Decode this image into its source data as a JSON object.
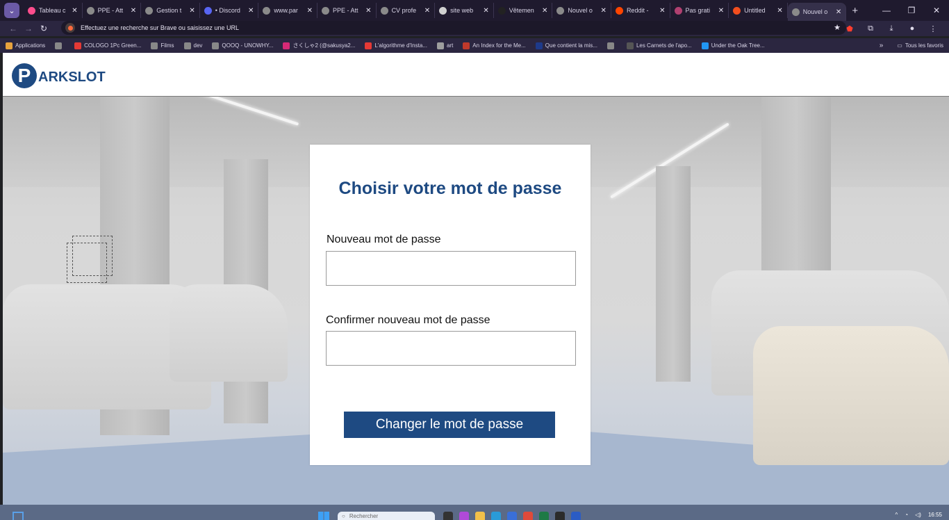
{
  "browser": {
    "tabs": [
      {
        "label": "Tableau c",
        "color": "#ff4d8d",
        "icon": "invision-icon"
      },
      {
        "label": "PPE - Att",
        "color": "#8a8a8a",
        "icon": "globe-icon"
      },
      {
        "label": "Gestion t",
        "color": "#8a8a8a",
        "icon": "gear-icon"
      },
      {
        "label": "• Discord",
        "color": "#5865f2",
        "icon": "discord-icon"
      },
      {
        "label": "www.par",
        "color": "#8a8a8a",
        "icon": "globe-icon"
      },
      {
        "label": "PPE - Att",
        "color": "#8a8a8a",
        "icon": "globe-icon"
      },
      {
        "label": "CV profe",
        "color": "#8a8a8a",
        "icon": "globe-icon"
      },
      {
        "label": "site web",
        "color": "#d0d0d0",
        "icon": "brave-icon"
      },
      {
        "label": "Vêtemen",
        "color": "#222222",
        "icon": "b-icon"
      },
      {
        "label": "Nouvel o",
        "color": "#8a8a8a",
        "icon": "globe-icon"
      },
      {
        "label": "Reddit -",
        "color": "#ff4500",
        "icon": "reddit-icon"
      },
      {
        "label": "Pas grati",
        "color": "#b04070",
        "icon": "globe-icon"
      },
      {
        "label": "Untitled",
        "color": "#f24e1e",
        "icon": "figma-icon"
      },
      {
        "label": "Nouvel o",
        "color": "#8a8a8a",
        "icon": "globe-icon"
      }
    ],
    "new_tab": "+",
    "address": "Effectuez une recherche sur Brave ou saisissez une URL",
    "bookmarks": [
      {
        "label": "Applications",
        "color": "#e8a33d"
      },
      {
        "label": "",
        "color": "#888888"
      },
      {
        "label": "COLOGO 1Pc Green...",
        "color": "#e53935"
      },
      {
        "label": "Films",
        "color": "#888888"
      },
      {
        "label": "dev",
        "color": "#888888"
      },
      {
        "label": "QOOQ - UNOWHY...",
        "color": "#888888"
      },
      {
        "label": "さくしゃ2 (@sakusya2...",
        "color": "#d62976"
      },
      {
        "label": "L'algorithme d'Insta...",
        "color": "#e53935"
      },
      {
        "label": "art",
        "color": "#9e9e9e"
      },
      {
        "label": "An Index for the Me...",
        "color": "#c0392b"
      },
      {
        "label": "Que contient la mis...",
        "color": "#1e3a8a"
      },
      {
        "label": "",
        "color": "#888888"
      },
      {
        "label": "Les Carnets de l'apo...",
        "color": "#555555"
      },
      {
        "label": "Under the Oak Tree...",
        "color": "#2196f3"
      }
    ],
    "all_bookmarks": "Tous les favoris"
  },
  "site": {
    "logo_letter": "P",
    "logo_text": "ARKSLOT",
    "brand_color": "#1e4a82"
  },
  "form": {
    "title": "Choisir votre mot de passe",
    "new_password_label": "Nouveau mot de passe",
    "new_password_value": "",
    "confirm_password_label": "Confirmer nouveau mot de passe",
    "confirm_password_value": "",
    "submit_label": "Changer le mot de passe"
  },
  "taskbar": {
    "search_placeholder": "Rechercher",
    "time": "16:55"
  }
}
